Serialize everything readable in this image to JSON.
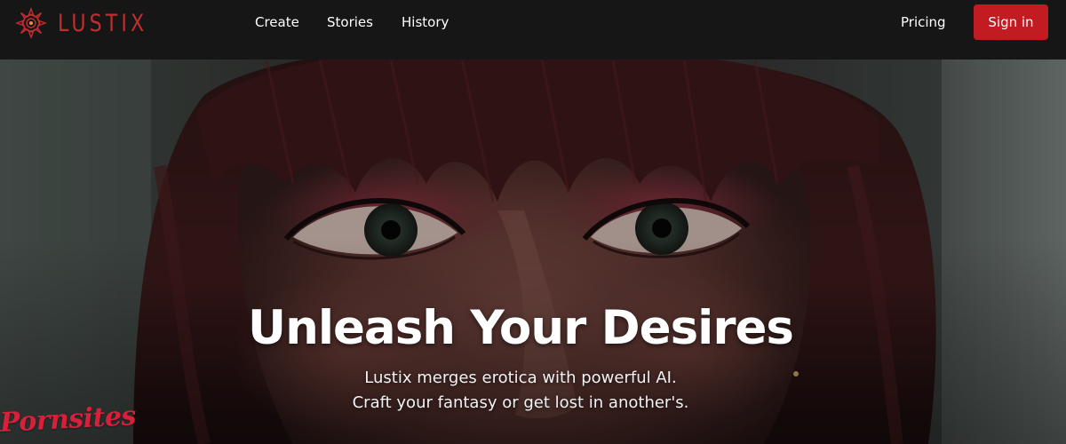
{
  "brand": {
    "name": "LUSTIX",
    "logo_icon": "mandala-logo-icon",
    "color": "#c22d2f"
  },
  "nav": {
    "items": [
      {
        "label": "Create"
      },
      {
        "label": "Stories"
      },
      {
        "label": "History"
      }
    ],
    "pricing_label": "Pricing",
    "signin_label": "Sign in",
    "signin_color": "#c21c22"
  },
  "hero": {
    "image": "close-up portrait of a woman with auburn hair and bangs",
    "title": "Unleash Your Desires",
    "subtitle_line1": "Lustix merges erotica with powerful AI.",
    "subtitle_line2": "Craft your fantasy or get lost in another's."
  },
  "watermark": {
    "text": "Pornsites"
  },
  "colors": {
    "navbar_bg": "#161616",
    "accent": "#c21c22"
  }
}
